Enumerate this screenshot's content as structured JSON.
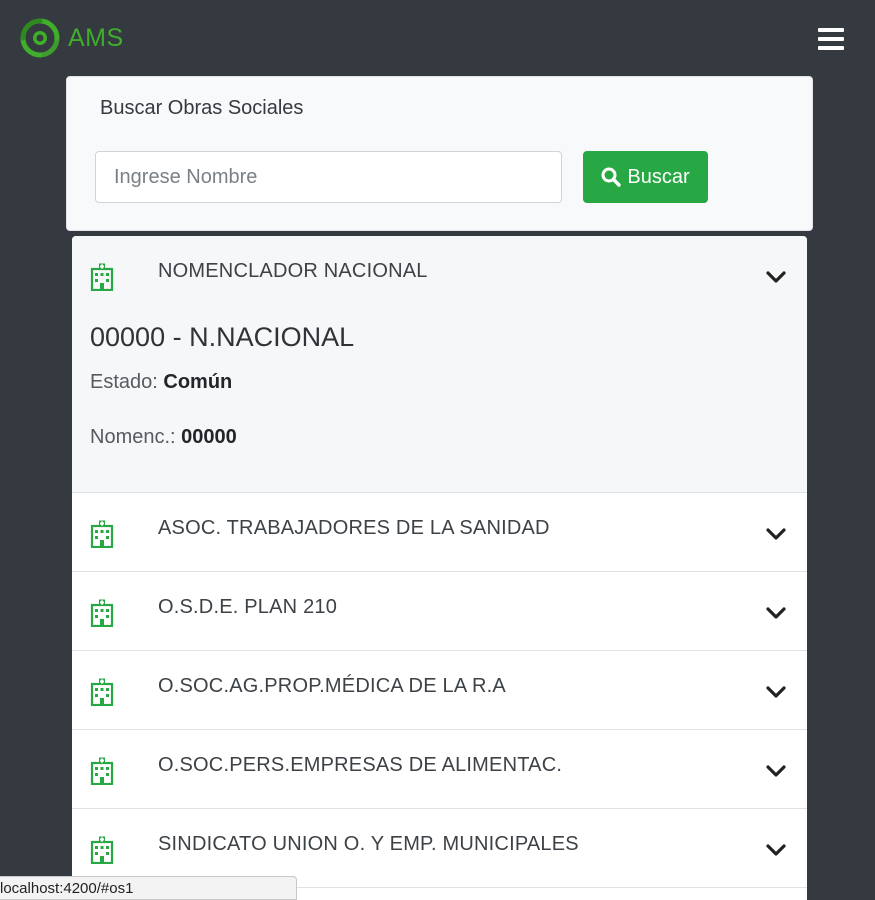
{
  "app": {
    "brand_name": "AMS",
    "brand_color": "#3fae2a",
    "menu_icon": "hamburger-menu-icon"
  },
  "search": {
    "title": "Buscar Obras Sociales",
    "placeholder": "Ingrese Nombre",
    "value": "",
    "button_label": "Buscar",
    "button_icon": "search-icon",
    "button_color": "#28a745"
  },
  "list": {
    "item_icon": "hospital-icon",
    "expand_icon": "chevron-down-icon",
    "items": [
      {
        "name": "NOMENCLADOR NACIONAL",
        "expanded": true,
        "detail_title": "00000 - N.NACIONAL",
        "estado_label": "Estado:",
        "estado_value": "Común",
        "nomenc_label": "Nomenc.:",
        "nomenc_value": "00000"
      },
      {
        "name": "ASOC. TRABAJADORES DE LA SANIDAD",
        "expanded": false
      },
      {
        "name": "O.S.D.E. PLAN 210",
        "expanded": false
      },
      {
        "name": "O.SOC.AG.PROP.MÉDICA DE LA R.A",
        "expanded": false
      },
      {
        "name": "O.SOC.PERS.EMPRESAS DE ALIMENTAC.",
        "expanded": false
      },
      {
        "name": "SINDICATO UNION O. Y EMP. MUNICIPALES",
        "expanded": false
      }
    ]
  },
  "status_bar": {
    "url": "localhost:4200/#os1"
  }
}
